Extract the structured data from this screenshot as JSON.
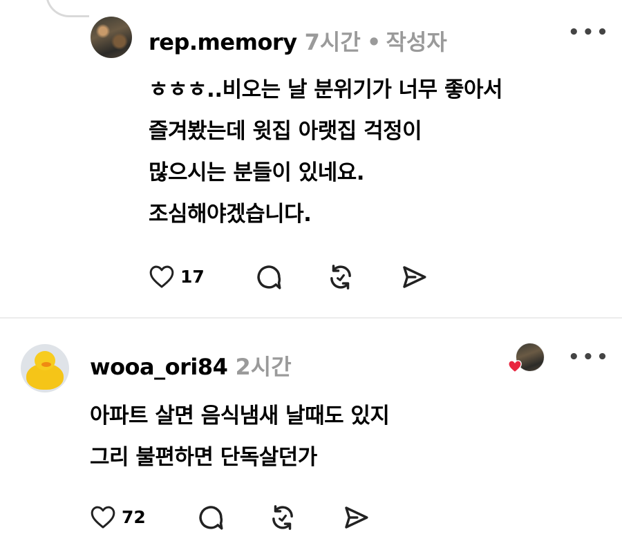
{
  "comments": [
    {
      "username": "rep.memory",
      "time": "7시간",
      "separator": "•",
      "author_tag": "작성자",
      "lines": [
        "ㅎㅎㅎ..비오는 날 분위기가 너무 좋아서",
        "즐겨봤는데 윗집 아랫집 걱정이",
        "많으시는 분들이 있네요.",
        "조심해야겠습니다."
      ],
      "likes": "17"
    },
    {
      "username": "wooa_ori84",
      "time": "2시간",
      "lines": [
        "아파트 살면 음식냄새 날때도 있지",
        "그리 불편하면 단독살던가"
      ],
      "likes": "72"
    }
  ],
  "more_label": "•••",
  "colors": {
    "heart_badge": "#e8253f",
    "meta": "#9a9a9a"
  },
  "icons": [
    "heart-icon",
    "comment-icon",
    "repost-icon",
    "share-icon",
    "more-icon"
  ]
}
